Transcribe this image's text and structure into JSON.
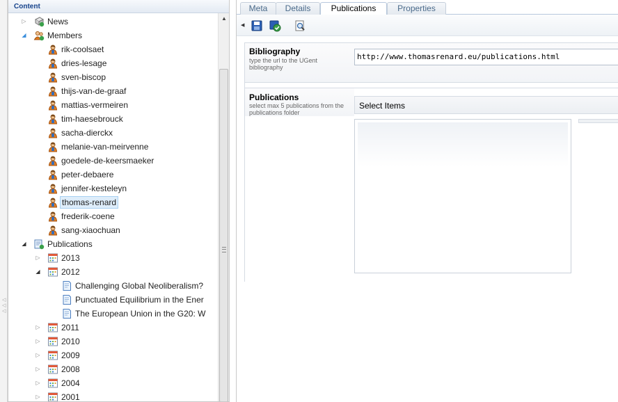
{
  "left_panel": {
    "header": "Content",
    "tree": [
      {
        "label": "News",
        "icon": "news-icon",
        "expander": "collapsed",
        "indent": 1
      },
      {
        "label": "Members",
        "icon": "members-icon",
        "expander": "expanded",
        "indent": 1
      },
      {
        "label": "rik-coolsaet",
        "icon": "user-icon",
        "indent": 2
      },
      {
        "label": "dries-lesage",
        "icon": "user-icon",
        "indent": 2
      },
      {
        "label": "sven-biscop",
        "icon": "user-icon",
        "indent": 2
      },
      {
        "label": "thijs-van-de-graaf",
        "icon": "user-icon",
        "indent": 2
      },
      {
        "label": "mattias-vermeiren",
        "icon": "user-icon",
        "indent": 2
      },
      {
        "label": "tim-haesebrouck",
        "icon": "user-icon",
        "indent": 2
      },
      {
        "label": "sacha-dierckx",
        "icon": "user-icon",
        "indent": 2
      },
      {
        "label": "melanie-van-meirvenne",
        "icon": "user-icon",
        "indent": 2
      },
      {
        "label": "goedele-de-keersmaeker",
        "icon": "user-icon",
        "indent": 2
      },
      {
        "label": "peter-debaere",
        "icon": "user-icon",
        "indent": 2
      },
      {
        "label": "jennifer-kesteleyn",
        "icon": "user-icon",
        "indent": 2
      },
      {
        "label": "thomas-renard",
        "icon": "user-icon",
        "indent": 2,
        "selected": true
      },
      {
        "label": "frederik-coene",
        "icon": "user-icon",
        "indent": 2
      },
      {
        "label": "sang-xiaochuan",
        "icon": "user-icon",
        "indent": 2
      },
      {
        "label": "Publications",
        "icon": "publications-folder-icon",
        "expander": "expanded",
        "indent": 1
      },
      {
        "label": "2013",
        "icon": "calendar-icon",
        "expander": "collapsed",
        "indent": 2
      },
      {
        "label": "2012",
        "icon": "calendar-icon",
        "expander": "expanded",
        "indent": 2
      },
      {
        "label": "Challenging Global Neoliberalism?",
        "icon": "document-icon",
        "indent": 3
      },
      {
        "label": "Punctuated Equilibrium in the Ener",
        "icon": "document-icon",
        "indent": 3
      },
      {
        "label": "The European Union in the G20: W",
        "icon": "document-icon",
        "indent": 3
      },
      {
        "label": "2011",
        "icon": "calendar-icon",
        "expander": "collapsed",
        "indent": 2
      },
      {
        "label": "2010",
        "icon": "calendar-icon",
        "expander": "collapsed",
        "indent": 2
      },
      {
        "label": "2009",
        "icon": "calendar-icon",
        "expander": "collapsed",
        "indent": 2
      },
      {
        "label": "2008",
        "icon": "calendar-icon",
        "expander": "collapsed",
        "indent": 2
      },
      {
        "label": "2004",
        "icon": "calendar-icon",
        "expander": "collapsed",
        "indent": 2
      },
      {
        "label": "2001",
        "icon": "calendar-icon",
        "expander": "collapsed",
        "indent": 2
      }
    ]
  },
  "tabs": [
    {
      "label": "Meta",
      "active": false
    },
    {
      "label": "Details",
      "active": false
    },
    {
      "label": "Publications",
      "active": true
    },
    {
      "label": "Properties",
      "active": false
    }
  ],
  "toolbar": {
    "buttons": [
      "save-icon",
      "save-publish-icon",
      "preview-icon"
    ]
  },
  "bibliography": {
    "title": "Bibliography",
    "help": "type the url to the UGent bibliography",
    "value": "http://www.thomasrenard.eu/publications.html"
  },
  "publications": {
    "title": "Publications",
    "help": "select max 5 publications from the publications folder",
    "select_label": "Select Items"
  },
  "colors": {
    "header_text": "#15428b",
    "selection_bg": "#deedfa",
    "tab_text": "#4a6a8a"
  }
}
